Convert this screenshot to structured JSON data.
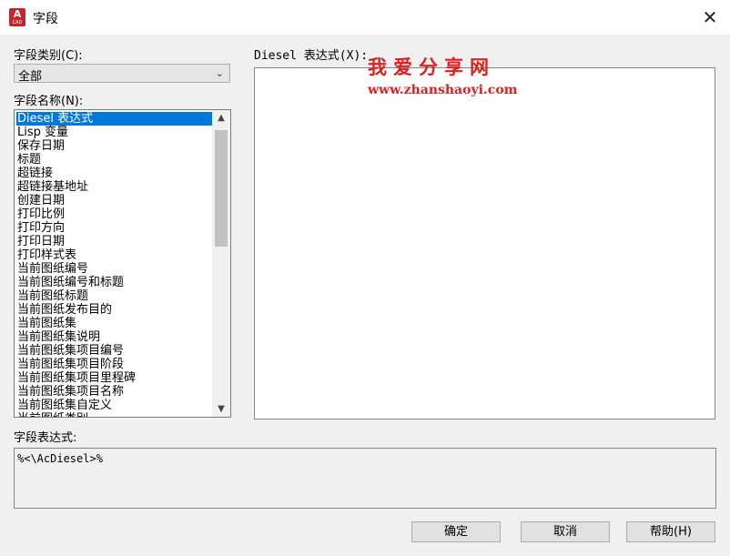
{
  "window": {
    "title": "字段",
    "app_icon_letter": "A",
    "app_icon_sub": "CAD",
    "close_glyph": "✕"
  },
  "category": {
    "label": "字段类别(C):",
    "value": "全部"
  },
  "field_names": {
    "label": "字段名称(N):",
    "items": [
      "Diesel 表达式",
      "Lisp 变量",
      "保存日期",
      "标题",
      "超链接",
      "超链接基地址",
      "创建日期",
      "打印比例",
      "打印方向",
      "打印日期",
      "打印样式表",
      "当前图纸编号",
      "当前图纸编号和标题",
      "当前图纸标题",
      "当前图纸发布目的",
      "当前图纸集",
      "当前图纸集说明",
      "当前图纸集项目编号",
      "当前图纸集项目阶段",
      "当前图纸集项目里程碑",
      "当前图纸集项目名称",
      "当前图纸集自定义",
      "当前图纸类别"
    ],
    "selected_index": 0
  },
  "diesel": {
    "label": "Diesel 表达式(X):"
  },
  "watermark": {
    "text": "我爱分享网",
    "url": "www.zhanshaoyi.com"
  },
  "field_expression": {
    "label": "字段表达式:",
    "value": "%<\\AcDiesel>%"
  },
  "buttons": {
    "ok": "确定",
    "cancel": "取消",
    "help": "帮助(H)"
  },
  "colors": {
    "selection": "#0078d7",
    "watermark": "#e02020",
    "app_icon": "#c4262e"
  }
}
